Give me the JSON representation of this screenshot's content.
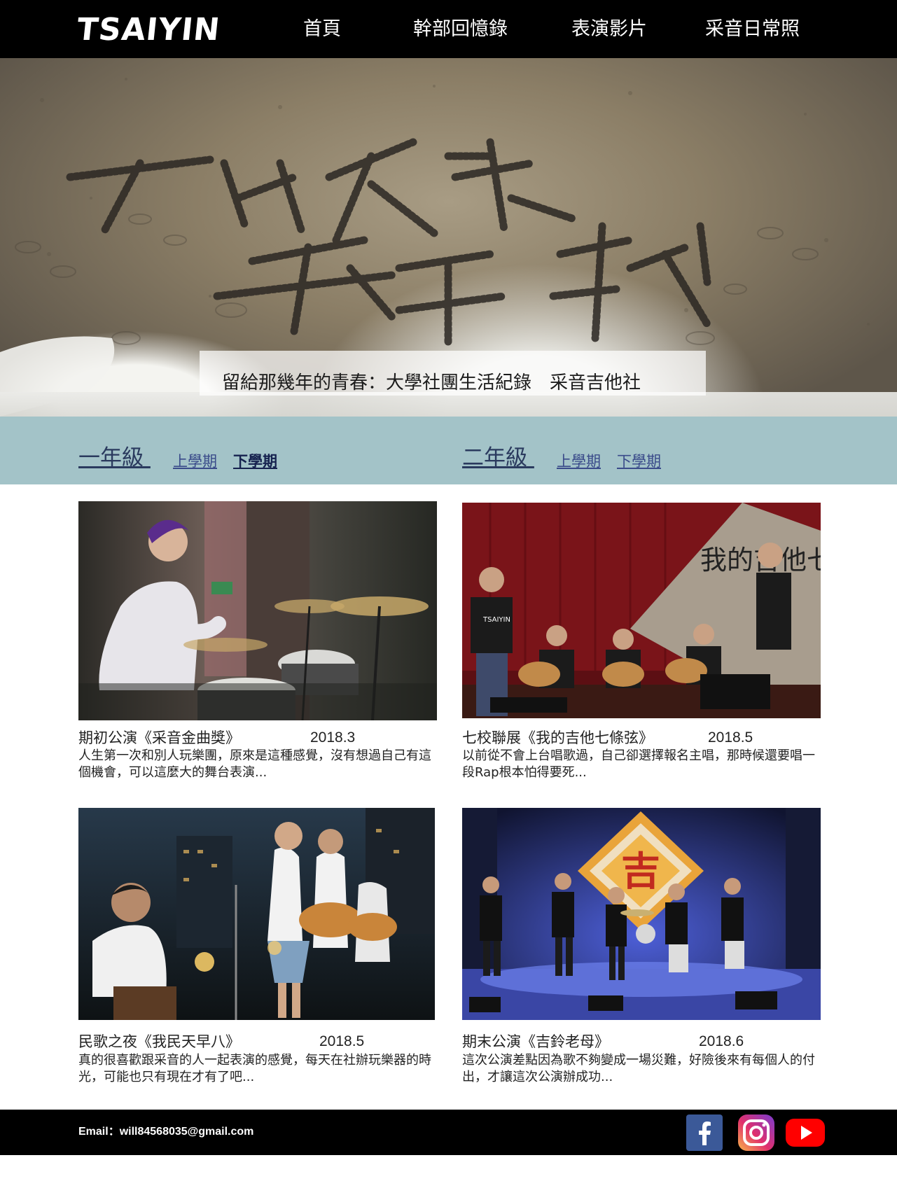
{
  "header": {
    "logo": "TSAIYIN",
    "nav": [
      "首頁",
      "幹部回憶錄",
      "表演影片",
      "采音日常照"
    ]
  },
  "hero": {
    "caption": "留給那幾年的青春：大學社團生活紀錄　采音吉他社"
  },
  "tabs": {
    "grade1": {
      "label": "一年級 ",
      "terms": [
        "上學期",
        "下學期"
      ],
      "active_term": "下學期"
    },
    "grade2": {
      "label": "二年級 ",
      "terms": [
        "上學期",
        "下學期"
      ]
    }
  },
  "cards": [
    {
      "title": "期初公演《采音金曲獎》",
      "date": "2018.3",
      "desc": "人生第一次和別人玩樂團，原來是這種感覺，沒有想過自己有這個機會，可以這麼大的舞台表演..."
    },
    {
      "title": "七校聯展《我的吉他七條弦》",
      "date": "2018.5",
      "desc": "以前從不會上台唱歌過，自己卻選擇報名主唱，那時候還要唱一段Rap根本怕得要死..."
    },
    {
      "title": "民歌之夜《我民天早八》",
      "date": "2018.5",
      "desc": "真的很喜歡跟采音的人一起表演的感覺，每天在社辦玩樂器的時光，可能也只有現在才有了吧..."
    },
    {
      "title": "期末公演《吉鈴老母》",
      "date": "2018.6",
      "desc": "這次公演差點因為歌不夠變成一場災難，好險後來有每個人的付出，才讓這次公演辦成功..."
    }
  ],
  "photos": {
    "card2_banner": "我的吉他七條弦展",
    "card2_shirt": "TSAIYIN",
    "card4_banner": "吉"
  },
  "footer": {
    "email": "Email：will84568035@gmail.com",
    "social": [
      "facebook-icon",
      "instagram-icon",
      "youtube-icon"
    ]
  },
  "colors": {
    "band": "#a3c3c8",
    "facebook": "#3b5998",
    "youtube": "#ff0000"
  }
}
